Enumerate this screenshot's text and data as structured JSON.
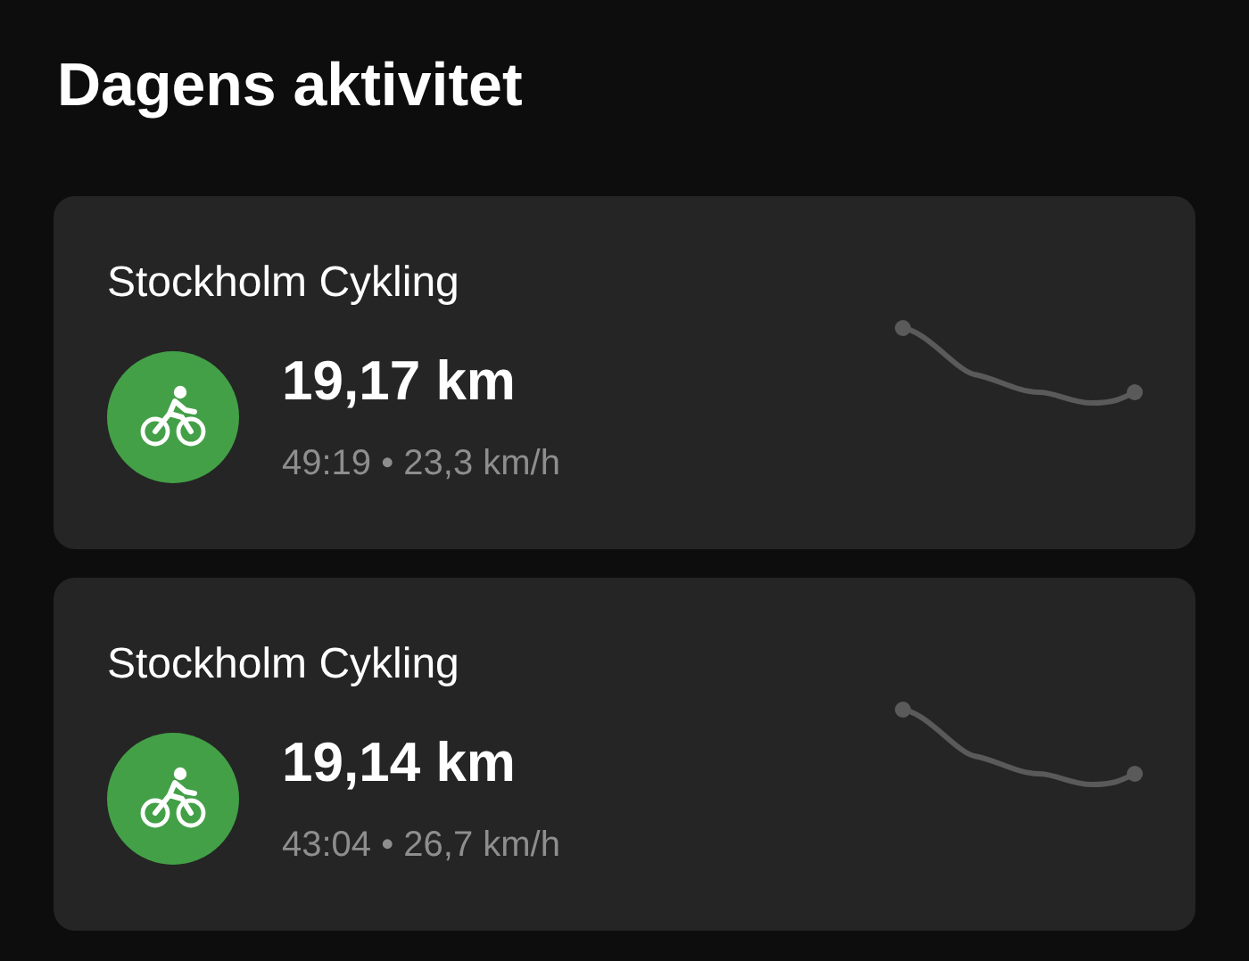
{
  "title": "Dagens aktivitet",
  "activities": [
    {
      "kind": "cycling",
      "name": "Stockholm Cykling",
      "distance": "19,17 km",
      "stats": "49:19 • 23,3 km/h"
    },
    {
      "kind": "cycling",
      "name": "Stockholm Cykling",
      "distance": "19,14 km",
      "stats": "43:04 • 26,7 km/h"
    }
  ]
}
